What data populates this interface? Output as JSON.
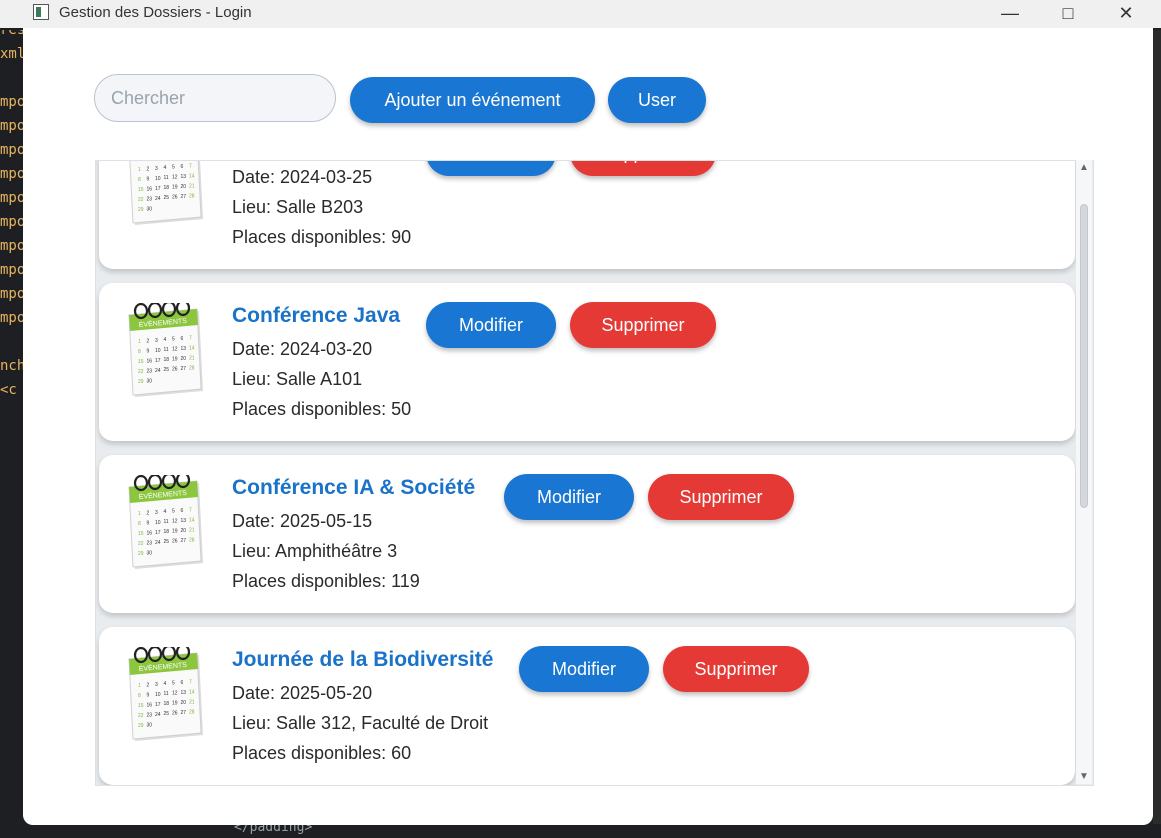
{
  "window": {
    "title": "Gestion des Dossiers - Login"
  },
  "toolbar": {
    "search_placeholder": "Chercher",
    "add_label": "Ajouter un événement",
    "user_label": "User"
  },
  "events": [
    {
      "title": "",
      "date": "Date: 2024-03-25",
      "lieu": "Lieu: Salle B203",
      "places": "Places disponibles: 90",
      "modify": "Modifier",
      "delete": "Supprimer"
    },
    {
      "title": "Conférence Java",
      "date": "Date: 2024-03-20",
      "lieu": "Lieu: Salle A101",
      "places": "Places disponibles: 50",
      "modify": "Modifier",
      "delete": "Supprimer"
    },
    {
      "title": "Conférence IA & Société",
      "date": "Date: 2025-05-15",
      "lieu": "Lieu: Amphithéâtre 3",
      "places": "Places disponibles: 119",
      "modify": "Modifier",
      "delete": "Supprimer"
    },
    {
      "title": "Journée de la Biodiversité",
      "date": "Date: 2025-05-20",
      "lieu": "Lieu: Salle 312, Faculté de Droit",
      "places": "Places disponibles: 60",
      "modify": "Modifier",
      "delete": "Supprimer"
    }
  ],
  "calendar_icon": {
    "label": "ÉVÉNEMENTS",
    "numbers": [
      "1",
      "2",
      "3",
      "4",
      "5",
      "6",
      "7",
      "8",
      "9",
      "10",
      "11",
      "12",
      "13",
      "14",
      "15",
      "16",
      "17",
      "18",
      "19",
      "20",
      "21",
      "22",
      "23",
      "24",
      "25",
      "26",
      "27",
      "28",
      "29",
      "30"
    ]
  },
  "background": {
    "closing_tag": "</padding>"
  },
  "colors": {
    "accent": "#1976d2",
    "danger": "#e53935",
    "title": "#1a73c8",
    "calendar_green": "#8cc63f"
  }
}
